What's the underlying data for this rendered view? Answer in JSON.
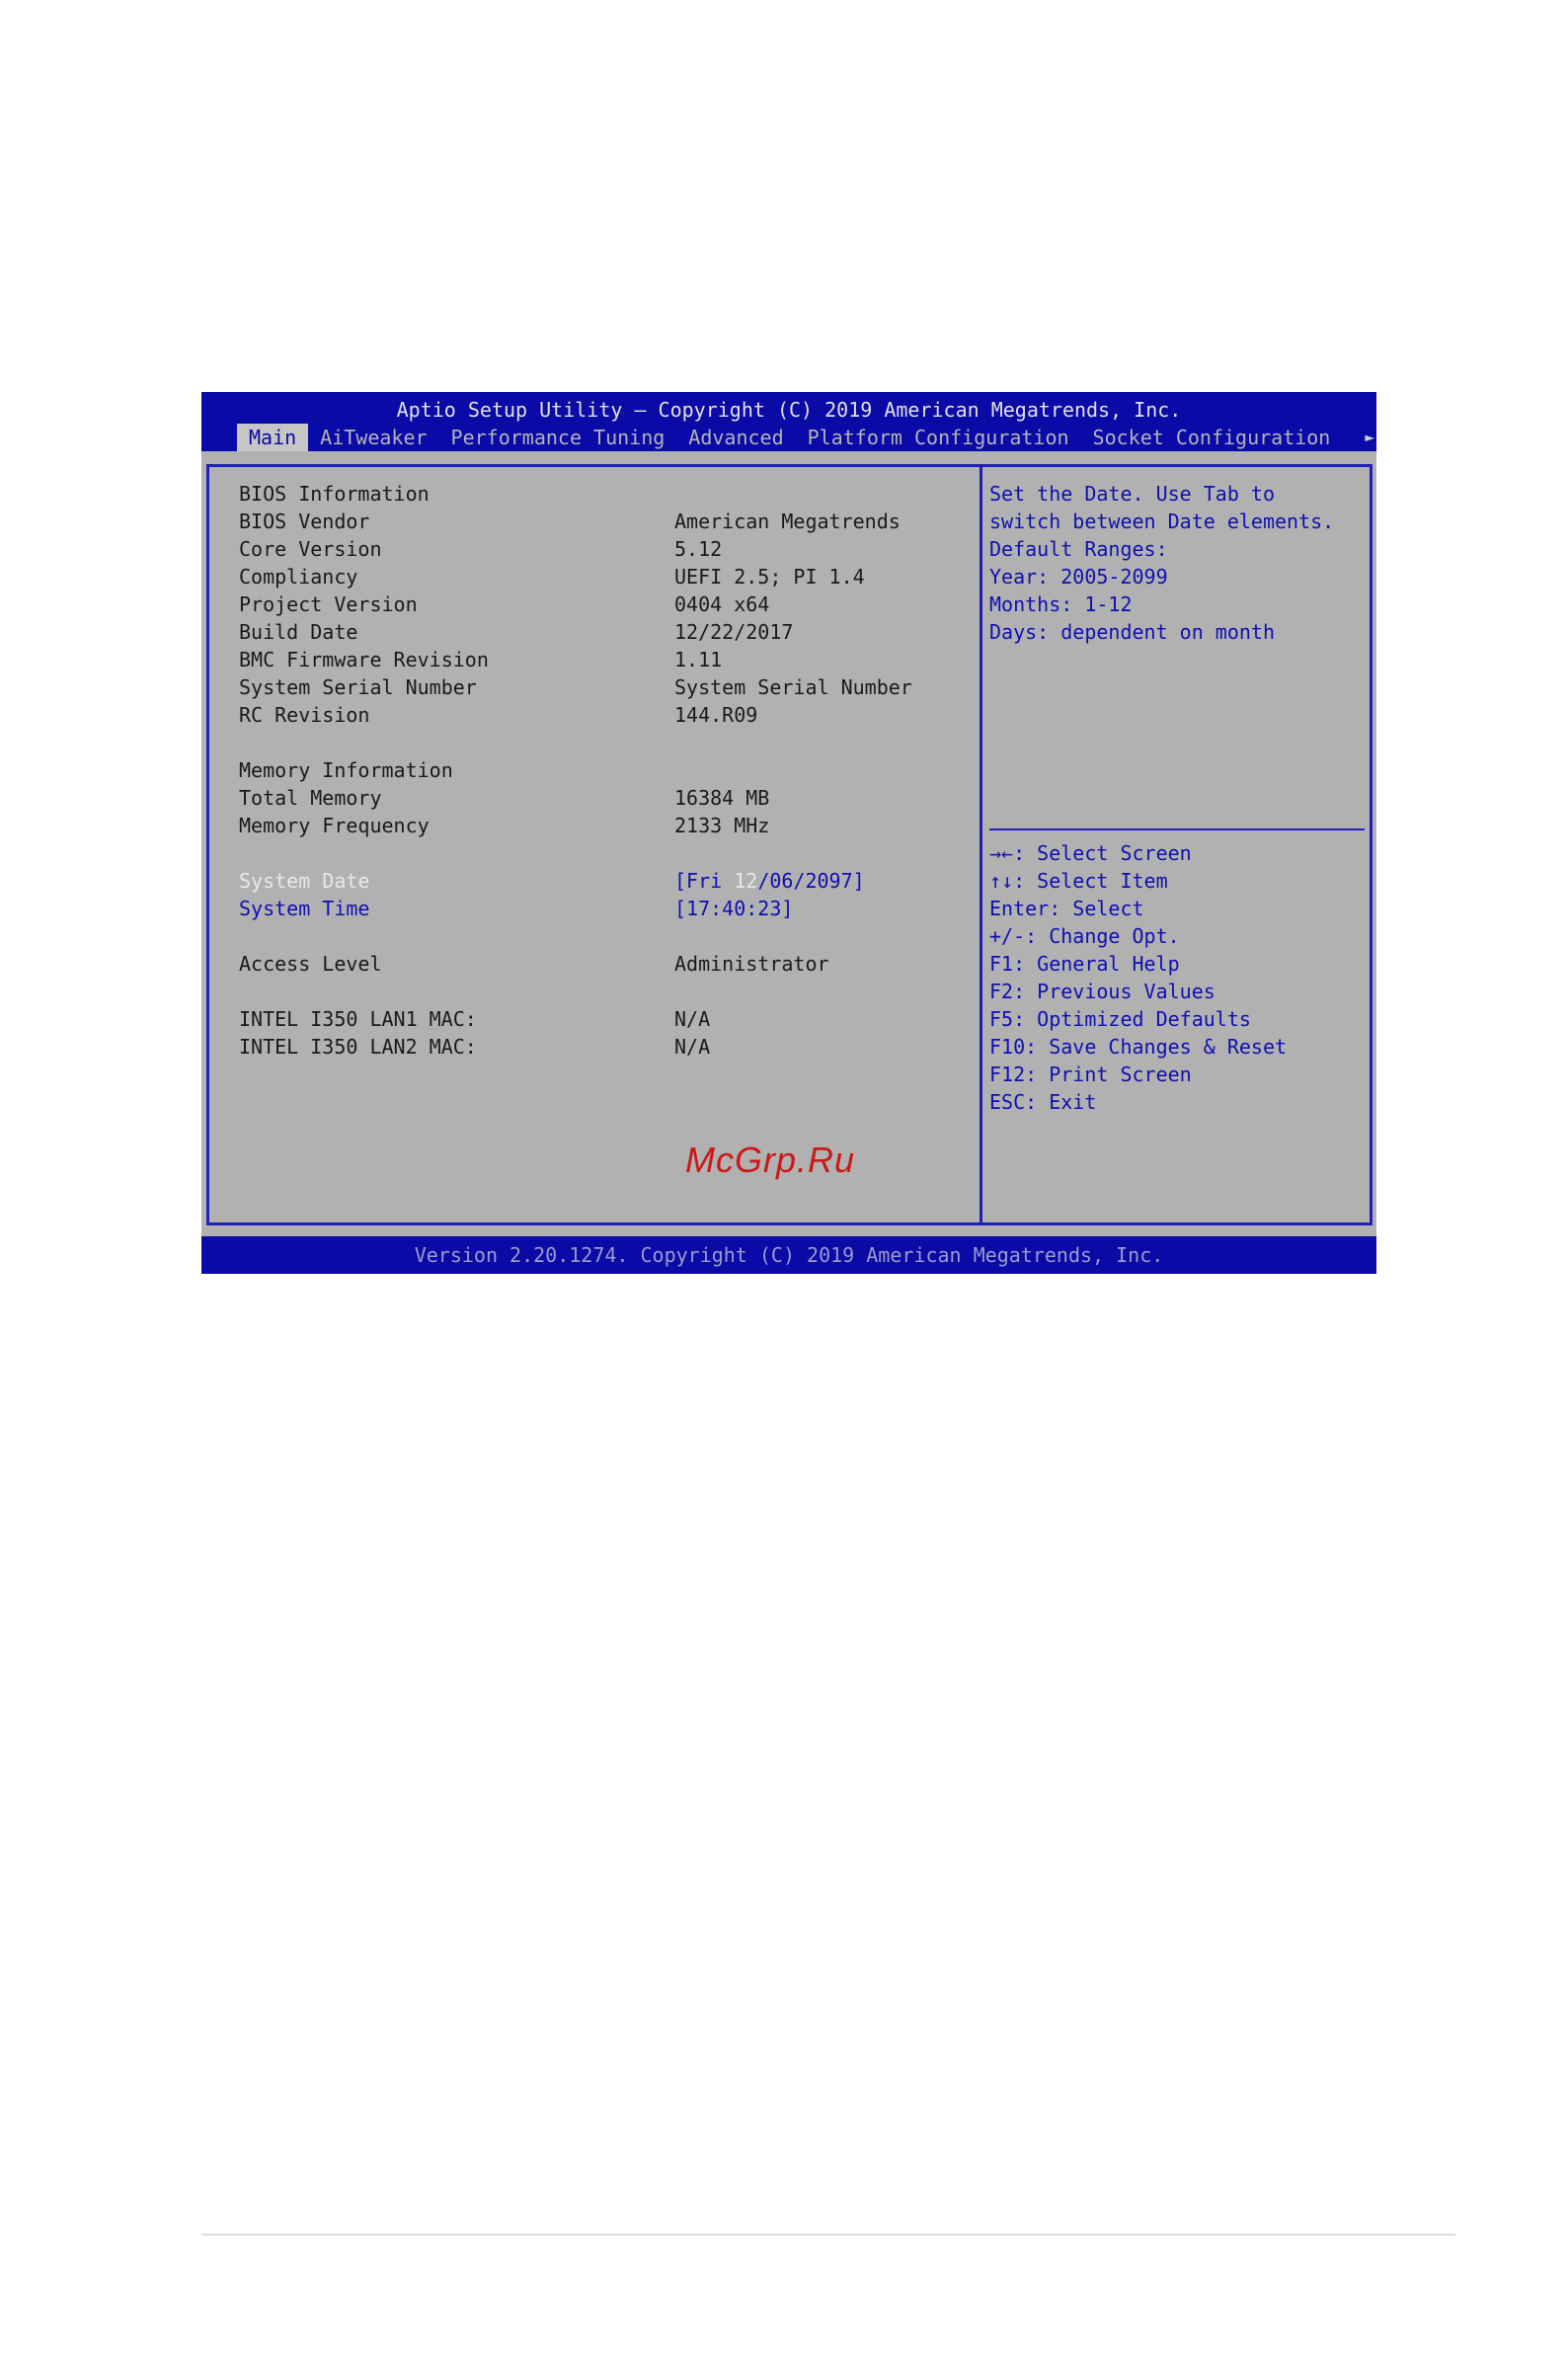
{
  "title": "Aptio Setup Utility – Copyright (C) 2019 American Megatrends, Inc.",
  "tabs": [
    {
      "label": "Main",
      "active": true
    },
    {
      "label": "AiTweaker",
      "active": false
    },
    {
      "label": "Performance Tuning",
      "active": false
    },
    {
      "label": "Advanced",
      "active": false
    },
    {
      "label": "Platform Configuration",
      "active": false
    },
    {
      "label": "Socket Configuration",
      "active": false
    }
  ],
  "more_arrow": "►",
  "main": {
    "bios_info_heading": "BIOS Information",
    "rows": [
      {
        "label": "BIOS Vendor",
        "value": "American Megatrends"
      },
      {
        "label": "Core Version",
        "value": "5.12"
      },
      {
        "label": "Compliancy",
        "value": "UEFI 2.5; PI 1.4"
      },
      {
        "label": "Project Version",
        "value": "0404 x64"
      },
      {
        "label": "Build Date",
        "value": "12/22/2017"
      },
      {
        "label": "BMC Firmware Revision",
        "value": "1.11"
      },
      {
        "label": "System Serial Number",
        "value": "System Serial Number"
      },
      {
        "label": "RC Revision",
        "value": "144.R09"
      }
    ],
    "memory_heading": "Memory Information",
    "memory_rows": [
      {
        "label": "Total Memory",
        "value": "16384 MB"
      },
      {
        "label": "Memory Frequency",
        "value": "2133 MHz"
      }
    ],
    "system_date": {
      "label": "System Date",
      "value_prefix": "[Fri ",
      "value_highlight": "12",
      "value_suffix": "/06/2097]"
    },
    "system_time": {
      "label": "System Time",
      "value": "[17:40:23]"
    },
    "access_level": {
      "label": "Access Level",
      "value": "Administrator"
    },
    "lan1": {
      "label": "INTEL I350 LAN1 MAC:",
      "value": "N/A"
    },
    "lan2": {
      "label": "INTEL I350 LAN2 MAC:",
      "value": "N/A"
    }
  },
  "help_lines": [
    "Set the Date. Use Tab to",
    "switch between Date elements.",
    "Default Ranges:",
    "Year: 2005-2099",
    "Months: 1-12",
    "Days: dependent on month"
  ],
  "key_lines": [
    "→←: Select Screen",
    "↑↓: Select Item",
    "Enter: Select",
    "+/-: Change Opt.",
    "F1: General Help",
    "F2: Previous Values",
    "F5: Optimized Defaults",
    "F10: Save Changes & Reset",
    "F12: Print Screen",
    "ESC: Exit"
  ],
  "watermark": "McGrp.Ru",
  "footer": "Version 2.20.1274. Copyright (C) 2019 American Megatrends, Inc."
}
